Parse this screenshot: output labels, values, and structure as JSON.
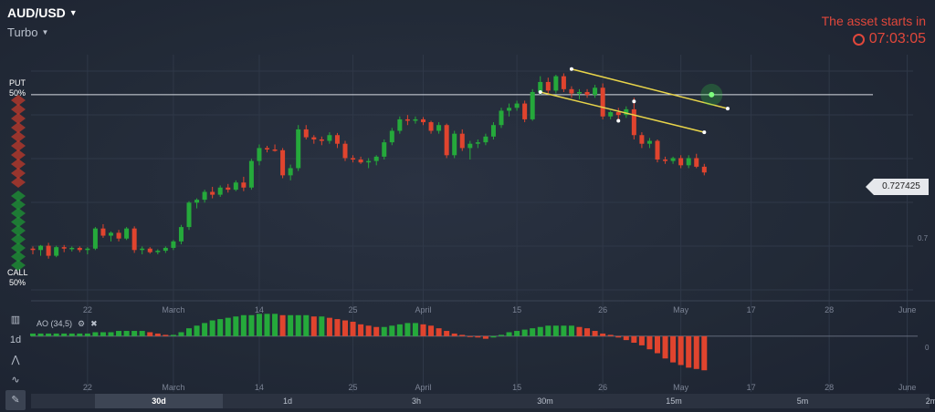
{
  "header": {
    "asset": "AUD/USD",
    "mode": "Turbo"
  },
  "notice": {
    "text": "The asset starts in",
    "timer": "07:03:05"
  },
  "sentiment": {
    "put_label": "PUT",
    "put_pct": "50%",
    "call_label": "CALL",
    "call_pct": "50%"
  },
  "price": {
    "current": "0.727425",
    "axis_label": "0.7",
    "ao_zero": "0"
  },
  "x_axis_labels": [
    "22",
    "March",
    "14",
    "25",
    "April",
    "15",
    "26",
    "May",
    "17",
    "28",
    "June"
  ],
  "indicator": {
    "name": "AO (34,5)"
  },
  "timeframes": [
    {
      "label": "30d",
      "active": true
    },
    {
      "label": "1d"
    },
    {
      "label": "3h"
    },
    {
      "label": "30m"
    },
    {
      "label": "15m"
    },
    {
      "label": "5m"
    },
    {
      "label": "2m"
    }
  ],
  "colors": {
    "up": "#25a93b",
    "down": "#e0442e",
    "channel": "#e8d44a",
    "alert": "#e0473b"
  },
  "chart_data": {
    "type": "candlestick",
    "candles": [
      [
        0.706,
        0.7063,
        0.7052,
        0.7058
      ],
      [
        0.7058,
        0.7065,
        0.705,
        0.7064
      ],
      [
        0.7064,
        0.7068,
        0.7046,
        0.705
      ],
      [
        0.705,
        0.7064,
        0.7048,
        0.7062
      ],
      [
        0.7062,
        0.7065,
        0.7055,
        0.706
      ],
      [
        0.706,
        0.7063,
        0.7056,
        0.7061
      ],
      [
        0.7061,
        0.7063,
        0.7055,
        0.7058
      ],
      [
        0.7058,
        0.7062,
        0.7052,
        0.706
      ],
      [
        0.706,
        0.709,
        0.7058,
        0.7088
      ],
      [
        0.7088,
        0.7094,
        0.7075,
        0.7078
      ],
      [
        0.7078,
        0.7084,
        0.707,
        0.7082
      ],
      [
        0.7082,
        0.7086,
        0.707,
        0.7074
      ],
      [
        0.7074,
        0.709,
        0.7072,
        0.7088
      ],
      [
        0.7088,
        0.7091,
        0.7054,
        0.7058
      ],
      [
        0.7058,
        0.7063,
        0.7052,
        0.706
      ],
      [
        0.706,
        0.7062,
        0.7053,
        0.7055
      ],
      [
        0.7055,
        0.7059,
        0.7052,
        0.7057
      ],
      [
        0.7057,
        0.7063,
        0.7054,
        0.7061
      ],
      [
        0.7061,
        0.7072,
        0.7058,
        0.707
      ],
      [
        0.707,
        0.7093,
        0.7066,
        0.709
      ],
      [
        0.709,
        0.7126,
        0.7086,
        0.7124
      ],
      [
        0.7124,
        0.713,
        0.7116,
        0.7128
      ],
      [
        0.7128,
        0.7142,
        0.7124,
        0.7139
      ],
      [
        0.7139,
        0.7146,
        0.713,
        0.7135
      ],
      [
        0.7135,
        0.7148,
        0.7132,
        0.7145
      ],
      [
        0.7145,
        0.715,
        0.7138,
        0.7142
      ],
      [
        0.7142,
        0.7155,
        0.714,
        0.7152
      ],
      [
        0.7152,
        0.716,
        0.714,
        0.7145
      ],
      [
        0.7145,
        0.7185,
        0.7142,
        0.7182
      ],
      [
        0.7182,
        0.7205,
        0.7176,
        0.72
      ],
      [
        0.72,
        0.7203,
        0.7194,
        0.7198
      ],
      [
        0.7198,
        0.7205,
        0.7195,
        0.7197
      ],
      [
        0.7197,
        0.72,
        0.7158,
        0.7162
      ],
      [
        0.7162,
        0.7177,
        0.7155,
        0.7172
      ],
      [
        0.7172,
        0.7232,
        0.7168,
        0.7226
      ],
      [
        0.7226,
        0.7232,
        0.7212,
        0.7215
      ],
      [
        0.7215,
        0.7218,
        0.7206,
        0.7212
      ],
      [
        0.7212,
        0.7216,
        0.7204,
        0.721
      ],
      [
        0.721,
        0.7222,
        0.7206,
        0.7218
      ],
      [
        0.7218,
        0.7221,
        0.72,
        0.7206
      ],
      [
        0.7206,
        0.721,
        0.7182,
        0.7186
      ],
      [
        0.7186,
        0.719,
        0.718,
        0.7184
      ],
      [
        0.7184,
        0.7188,
        0.7178,
        0.718
      ],
      [
        0.718,
        0.7186,
        0.7172,
        0.7182
      ],
      [
        0.7182,
        0.719,
        0.7176,
        0.7188
      ],
      [
        0.7188,
        0.7212,
        0.7184,
        0.7208
      ],
      [
        0.7208,
        0.7228,
        0.7204,
        0.7224
      ],
      [
        0.7224,
        0.7244,
        0.722,
        0.724
      ],
      [
        0.724,
        0.7246,
        0.7232,
        0.7238
      ],
      [
        0.7238,
        0.7244,
        0.7234,
        0.724
      ],
      [
        0.724,
        0.7243,
        0.7232,
        0.7236
      ],
      [
        0.7236,
        0.7238,
        0.722,
        0.7224
      ],
      [
        0.7224,
        0.7236,
        0.722,
        0.7232
      ],
      [
        0.7232,
        0.7234,
        0.7186,
        0.719
      ],
      [
        0.719,
        0.7224,
        0.7186,
        0.722
      ],
      [
        0.722,
        0.7226,
        0.7196,
        0.72
      ],
      [
        0.72,
        0.721,
        0.7184,
        0.7206
      ],
      [
        0.7206,
        0.7212,
        0.72,
        0.7208
      ],
      [
        0.7208,
        0.722,
        0.7204,
        0.7216
      ],
      [
        0.7216,
        0.7236,
        0.7212,
        0.7232
      ],
      [
        0.7232,
        0.7256,
        0.7228,
        0.7252
      ],
      [
        0.7252,
        0.7262,
        0.7244,
        0.7256
      ],
      [
        0.7256,
        0.7266,
        0.7252,
        0.7262
      ],
      [
        0.7262,
        0.7266,
        0.7236,
        0.724
      ],
      [
        0.724,
        0.7282,
        0.7238,
        0.7278
      ],
      [
        0.7278,
        0.73,
        0.7274,
        0.7292
      ],
      [
        0.7292,
        0.7298,
        0.7276,
        0.728
      ],
      [
        0.728,
        0.7302,
        0.7276,
        0.73
      ],
      [
        0.73,
        0.7304,
        0.7278,
        0.7282
      ],
      [
        0.7282,
        0.7286,
        0.727,
        0.7276
      ],
      [
        0.7276,
        0.7282,
        0.7268,
        0.7278
      ],
      [
        0.7278,
        0.7282,
        0.727,
        0.7274
      ],
      [
        0.7274,
        0.7288,
        0.727,
        0.7284
      ],
      [
        0.7284,
        0.729,
        0.724,
        0.7244
      ],
      [
        0.7244,
        0.7252,
        0.724,
        0.725
      ],
      [
        0.725,
        0.7256,
        0.7238,
        0.7246
      ],
      [
        0.7246,
        0.7258,
        0.7242,
        0.7254
      ],
      [
        0.7254,
        0.727,
        0.7212,
        0.7218
      ],
      [
        0.7218,
        0.7222,
        0.72,
        0.7206
      ],
      [
        0.7206,
        0.7214,
        0.72,
        0.721
      ],
      [
        0.721,
        0.7212,
        0.718,
        0.7184
      ],
      [
        0.7184,
        0.7188,
        0.7178,
        0.7182
      ],
      [
        0.7182,
        0.7188,
        0.7178,
        0.7186
      ],
      [
        0.7186,
        0.719,
        0.7172,
        0.7176
      ],
      [
        0.7176,
        0.719,
        0.7172,
        0.7186
      ],
      [
        0.7186,
        0.7192,
        0.7172,
        0.7174
      ],
      [
        0.7174,
        0.7178,
        0.7162,
        0.7166
      ]
    ],
    "candle_order": [
      "open",
      "high",
      "low",
      "close"
    ],
    "ylim": [
      0.7,
      0.733
    ],
    "horizontal_line": 0.727425,
    "channel_upper": [
      [
        69,
        0.731
      ],
      [
        89,
        0.7255
      ]
    ],
    "channel_lower": [
      [
        65,
        0.7278
      ],
      [
        86,
        0.7222
      ]
    ],
    "channel_markers": [
      [
        69,
        0.731
      ],
      [
        77,
        0.7265
      ],
      [
        89,
        0.7255
      ],
      [
        65,
        0.7278
      ],
      [
        75,
        0.7238
      ],
      [
        86,
        0.7222
      ]
    ],
    "ao_values": [
      2,
      2,
      2,
      2,
      2,
      2,
      2,
      2,
      3,
      3,
      3,
      4,
      4,
      4,
      4,
      3,
      2,
      1,
      1,
      3,
      6,
      8,
      10,
      12,
      13,
      14,
      15,
      16,
      16,
      17,
      17,
      17,
      16,
      16,
      16,
      16,
      15,
      15,
      14,
      13,
      12,
      11,
      9,
      8,
      7,
      7,
      8,
      9,
      10,
      10,
      9,
      8,
      6,
      4,
      2,
      1,
      0,
      -1,
      -2,
      -1,
      1,
      3,
      4,
      5,
      6,
      7,
      8,
      8,
      8,
      8,
      7,
      6,
      4,
      2,
      1,
      -1,
      -3,
      -5,
      -7,
      -10,
      -13,
      -17,
      -20,
      -22,
      -24,
      -25,
      -26
    ],
    "ao_ylim": [
      -30,
      20
    ],
    "x_label_index": [
      7,
      18,
      29,
      41,
      50,
      62,
      73,
      83,
      92,
      102,
      112
    ]
  }
}
